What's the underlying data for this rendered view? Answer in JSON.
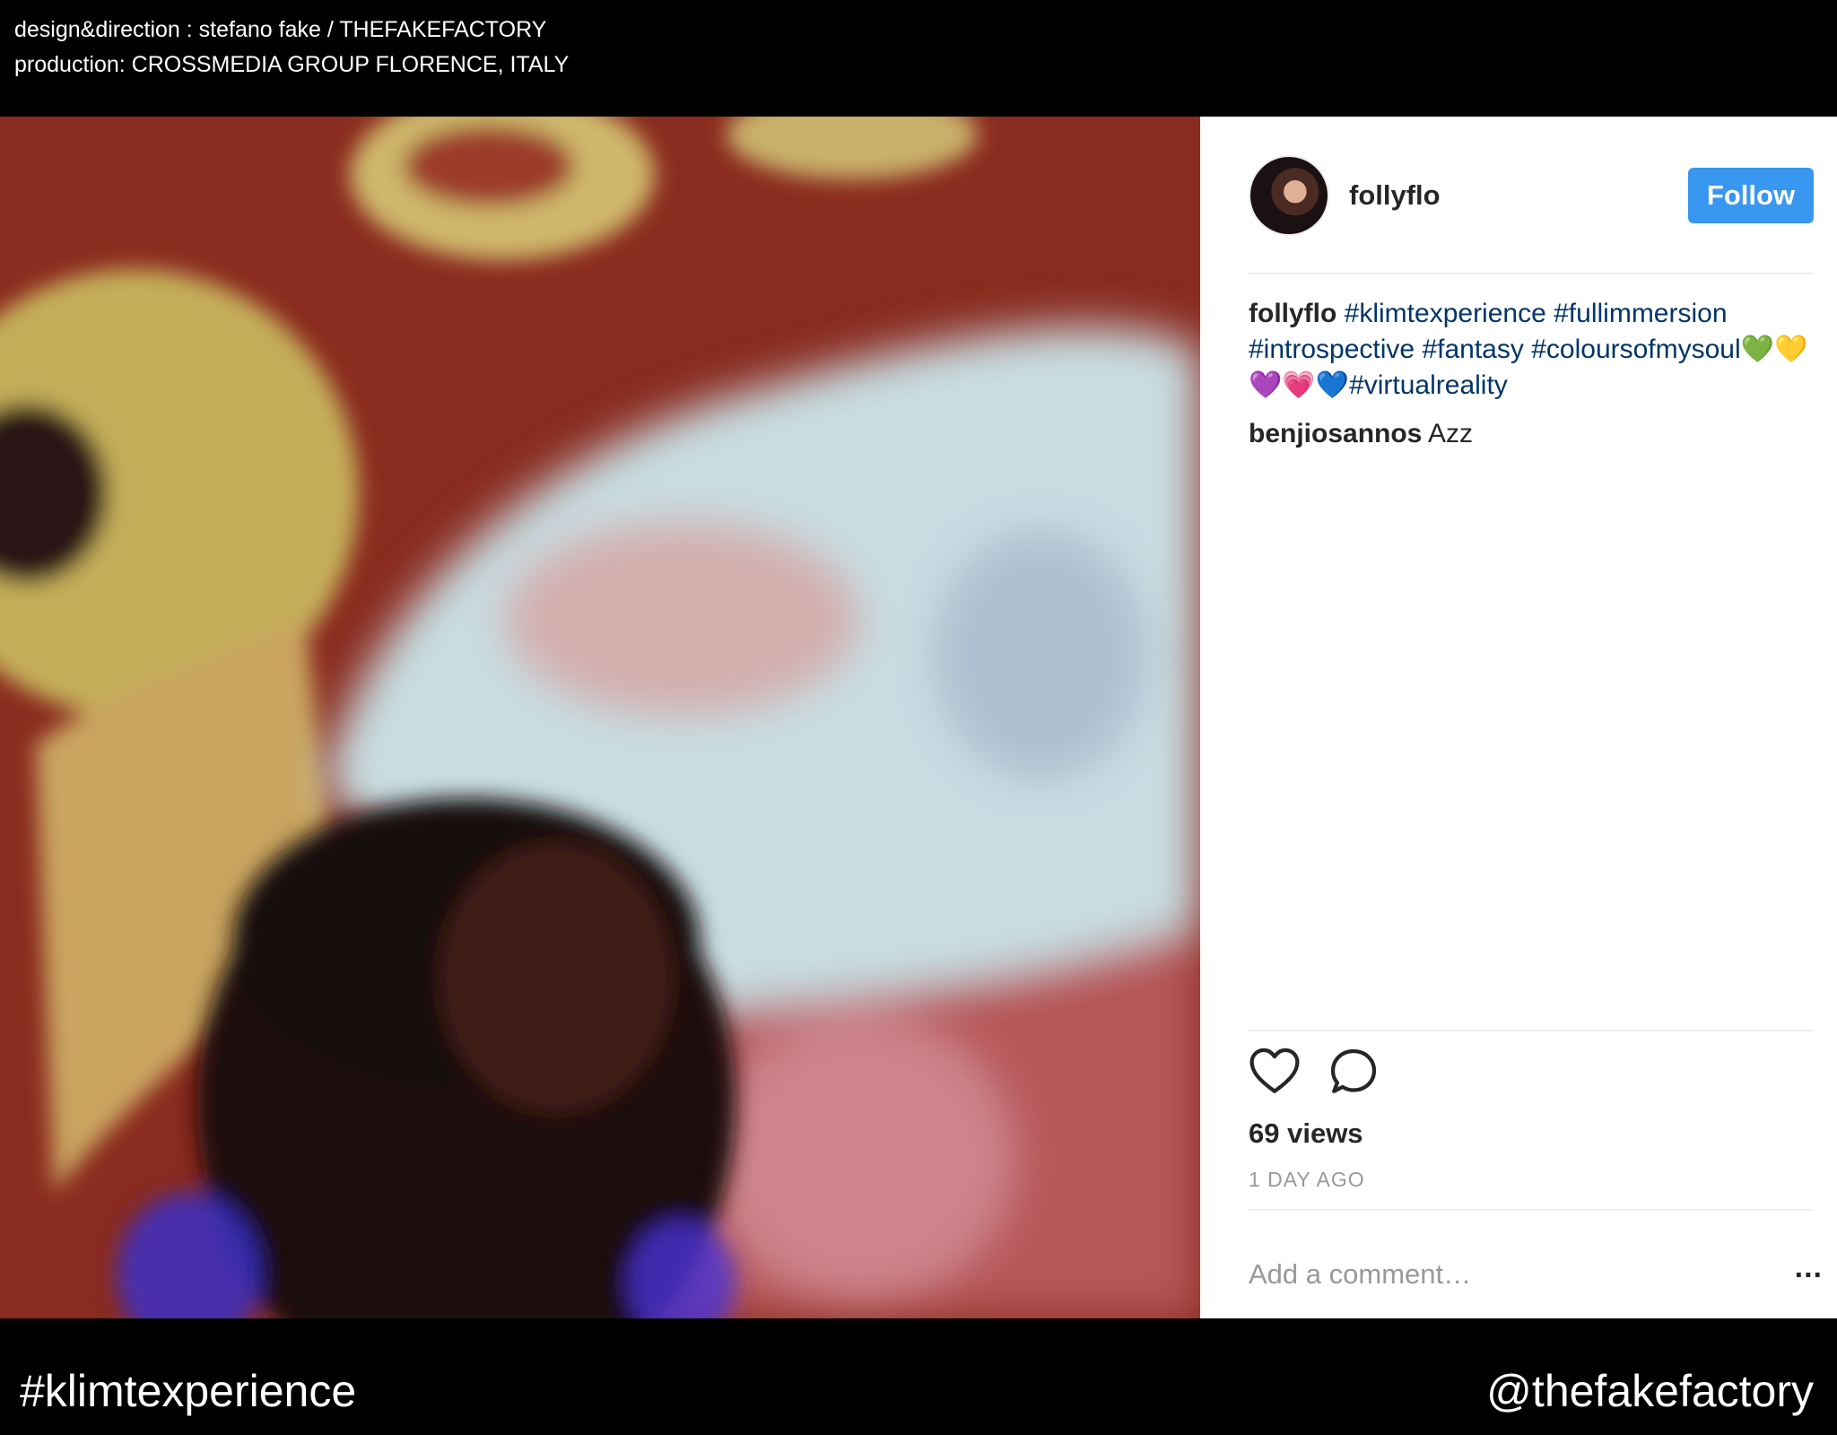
{
  "credits": {
    "line1": "design&direction : stefano fake / THEFAKEFACTORY",
    "line2": "production: CROSSMEDIA GROUP FLORENCE, ITALY"
  },
  "post": {
    "username": "follyflo",
    "follow_label": "Follow",
    "caption": {
      "user": "follyflo",
      "tags": [
        "#klimtexperience",
        "#fullimmersion",
        "#introspective",
        "#fantasy",
        "#coloursofmysoul"
      ],
      "emoji_line": "💚💛💜💗💙",
      "tag_end": "#virtualreality"
    },
    "comment": {
      "user": "benjiosannos",
      "text": "Azz"
    },
    "views": "69 views",
    "time": "1 DAY AGO",
    "add_comment_placeholder": "Add a comment…",
    "more_label": "...",
    "colors": {
      "follow": "#3897f0",
      "hashtag": "#003569"
    }
  },
  "footer": {
    "hashtag": "#klimtexperience",
    "handle": "@thefakefactory"
  }
}
